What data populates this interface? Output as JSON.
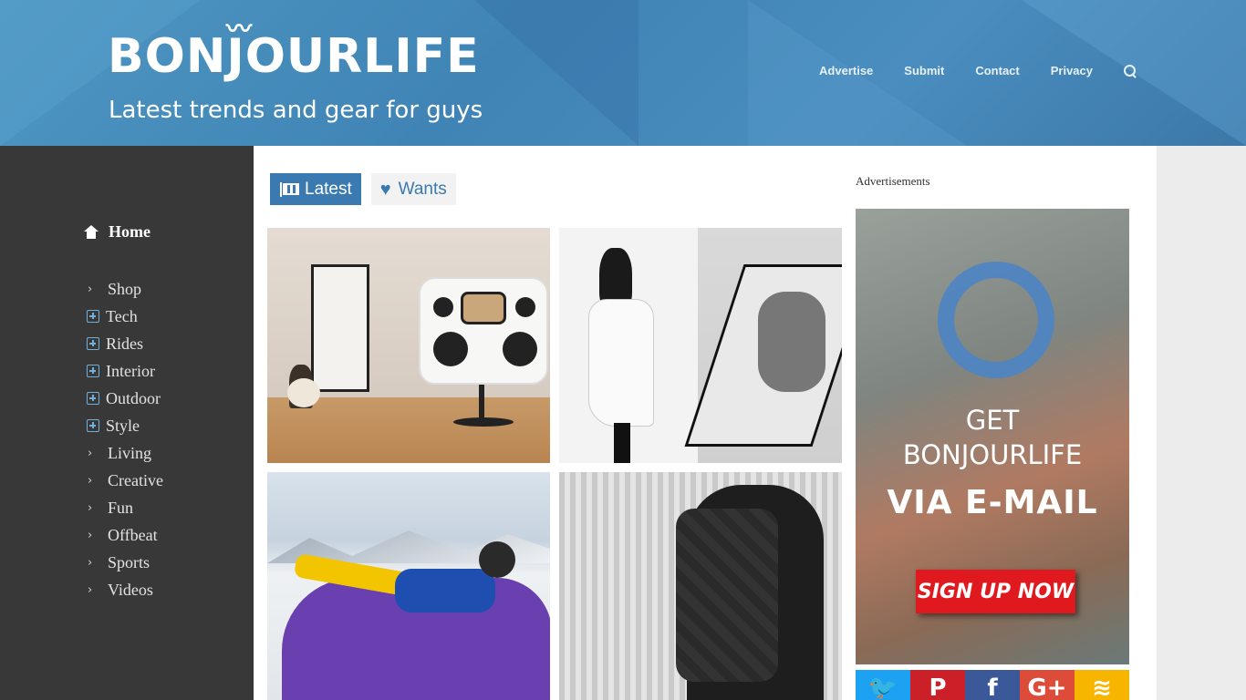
{
  "header": {
    "logo": "BONJOURLIFE",
    "tagline": "Latest trends and gear for guys",
    "nav": [
      "Advertise",
      "Submit",
      "Contact",
      "Privacy"
    ]
  },
  "sidebar": {
    "home": "Home",
    "categories": [
      {
        "label": "Shop",
        "icon": "chevron-right-icon"
      },
      {
        "label": "Tech",
        "icon": "plus-square-icon"
      },
      {
        "label": "Rides",
        "icon": "plus-square-icon"
      },
      {
        "label": "Interior",
        "icon": "plus-square-icon"
      },
      {
        "label": "Outdoor",
        "icon": "plus-square-icon"
      },
      {
        "label": "Style",
        "icon": "plus-square-icon"
      },
      {
        "label": "Living",
        "icon": "chevron-right-icon"
      },
      {
        "label": "Creative",
        "icon": "chevron-right-icon"
      },
      {
        "label": "Fun",
        "icon": "chevron-right-icon"
      },
      {
        "label": "Offbeat",
        "icon": "chevron-right-icon"
      },
      {
        "label": "Sports",
        "icon": "chevron-right-icon"
      },
      {
        "label": "Videos",
        "icon": "chevron-right-icon"
      }
    ]
  },
  "tabs": {
    "latest": "Latest",
    "wants": "Wants"
  },
  "ads": {
    "label": "Advertisements",
    "line1": "GET",
    "line2": "BONJOURLIFE",
    "line3": "VIA E-MAIL",
    "button": "SIGN UP NOW"
  },
  "social": [
    {
      "name": "twitter-icon",
      "glyph": "🐦",
      "color": "#1da1f2"
    },
    {
      "name": "pinterest-icon",
      "glyph": "P",
      "color": "#cb2027"
    },
    {
      "name": "facebook-icon",
      "glyph": "f",
      "color": "#3b5998"
    },
    {
      "name": "google-plus-icon",
      "glyph": "G+",
      "color": "#dd4b39"
    },
    {
      "name": "rss-icon",
      "glyph": "≋",
      "color": "#f7b500"
    }
  ]
}
